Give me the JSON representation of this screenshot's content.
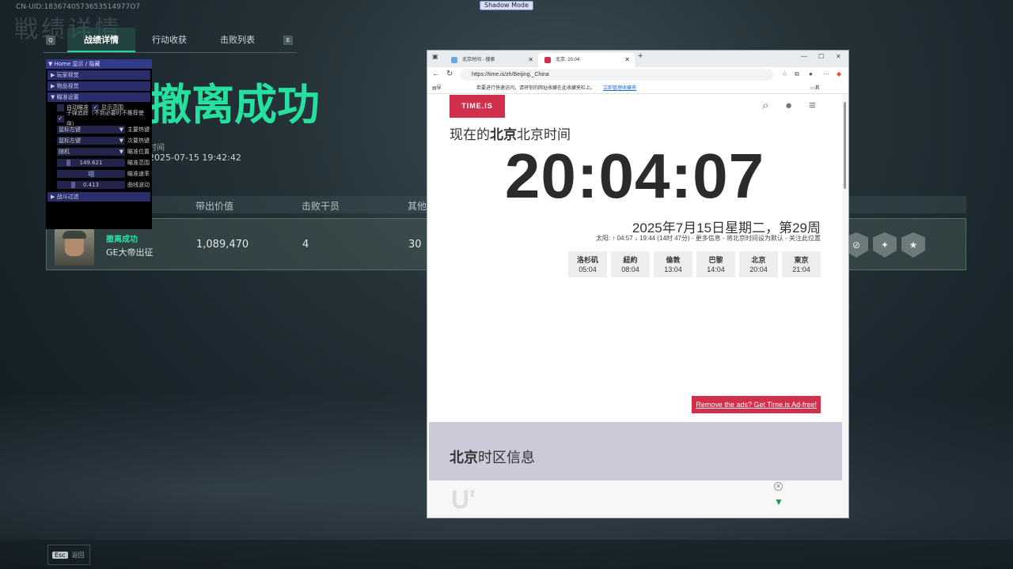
{
  "overlay": {
    "uid": "CN-UID:1836740573653514977O7",
    "shadow_mode": "Shadow Mode"
  },
  "game": {
    "bg_title": "戦绩详情",
    "tabs": {
      "left_key": "Q",
      "right_key": "E",
      "items": [
        "战绩详情",
        "行动收获",
        "击败列表"
      ]
    },
    "result_title": "撤离成功",
    "result_subtitle": "时间",
    "datetime": "2025-07-15 19:42:42",
    "table": {
      "headers": [
        "带出价值",
        "击败干员",
        "其他"
      ],
      "row": {
        "status": "撤离成功",
        "player": "GE大帝出征",
        "value": "1,089,470",
        "kills": "4",
        "other": "30"
      }
    },
    "esc": {
      "key": "Esc",
      "label": "返回"
    },
    "medals": [
      "⊘",
      "✦",
      "★"
    ]
  },
  "cheat_panel": {
    "title": "Home 显示 / 隐藏",
    "sections": {
      "players": "玩家视觉",
      "items": "物品视觉",
      "aim": "瞄准设置",
      "filter": "战斗过滤"
    },
    "aim_items": {
      "auto_aim": "自动瞄准",
      "show_range": "显示范围",
      "bullet_track": "子弹追踪（不到必要时不推荐使用）",
      "primary_key_value": "鼠标左键",
      "primary_key_label": "主要热键",
      "secondary_key_value": "鼠标左键",
      "secondary_key_label": "次要热键",
      "aim_pos_value": "随机",
      "aim_pos_label": "瞄准位置",
      "range_value": "149.621",
      "range_label": "瞄准范围",
      "speed_value": "11",
      "speed_label": "瞄准速率",
      "curve_value": "0.413",
      "curve_label": "曲线波动"
    }
  },
  "browser": {
    "tabs": [
      {
        "title": "北京时间 - 搜索"
      },
      {
        "title": "北京: 20:04"
      }
    ],
    "url": "https://time.is/zh/Beijing,_China",
    "favbar": {
      "import": "导入收藏夹",
      "hint": "若要进行快速访问，请将你的网址收藏在此收藏夹栏上。",
      "link": "立即管理收藏夹",
      "other": "其他收藏夹"
    },
    "page": {
      "logo": "TIME.IS",
      "heading_pre": "现在的",
      "heading_city": "北京",
      "heading_post": "北京时间",
      "clock": "20:04:07",
      "date": "2025年7月15日星期二，第29周",
      "sun": "太阳: ↑ 04:57 ↓ 19:44 (14时 47分) - 更多信息 - 将北京时间设为默认 - 关注此位置",
      "cities": [
        {
          "name": "洛杉矶",
          "time": "05:04"
        },
        {
          "name": "紐約",
          "time": "08:04"
        },
        {
          "name": "倫敦",
          "time": "13:04"
        },
        {
          "name": "巴黎",
          "time": "14:04"
        },
        {
          "name": "北京",
          "time": "20:04"
        },
        {
          "name": "東京",
          "time": "21:04"
        }
      ],
      "ad_button": "Remove the ads? Get Time.is Ad-free!",
      "tz_city": "北京",
      "tz_rest": "时区信息"
    }
  }
}
